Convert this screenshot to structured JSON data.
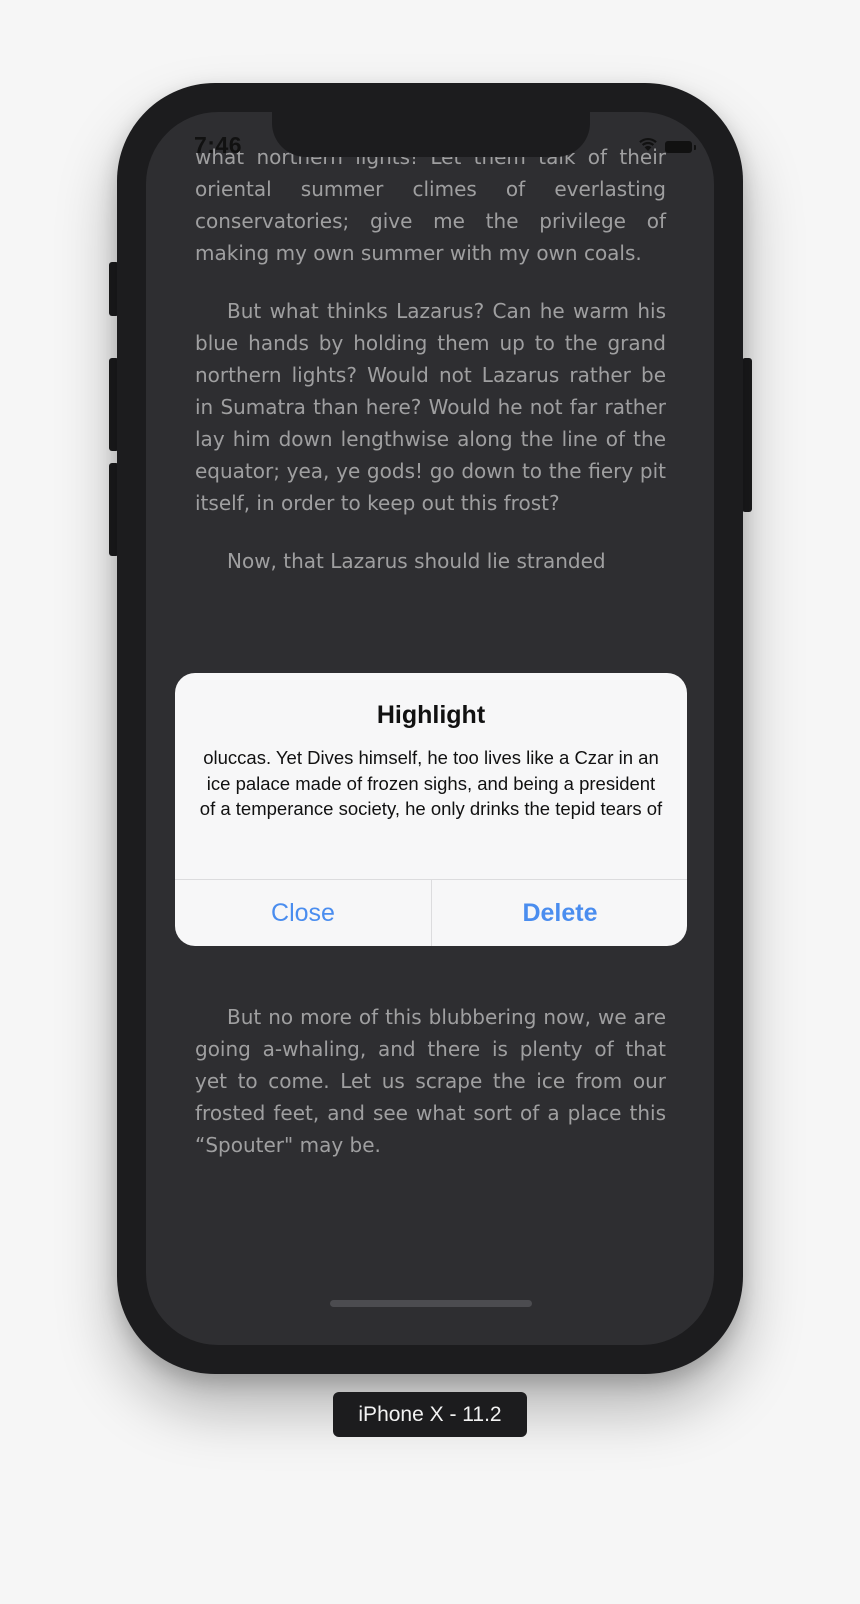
{
  "status_bar": {
    "time": "7:46",
    "icons": [
      "wifi-icon",
      "battery-icon"
    ]
  },
  "reader": {
    "paragraphs": [
      "what northern lights! Let them talk of their oriental summer climes of everlasting conservatories; give me the privilege of making my own summer with my own coals.",
      "But what thinks Lazarus? Can he warm his blue hands by holding them up to the grand northern lights? Would not Lazarus rather be in Sumatra than here? Would he not far rather lay him down lengthwise along the line of the equator; yea, ye gods! go down to the fiery pit itself, in order to keep out this frost?",
      "Now, that Lazarus should lie stranded",
      "But no more of this blubbering now, we are going a-whaling, and there is plenty of that yet to come. Let us scrape the ice from our frosted feet, and see what sort of a place this “Spouter\" may be."
    ]
  },
  "alert": {
    "title": "Highlight",
    "message": "oluccas. Yet Dives himself, he too lives like a Czar in an ice palace made of frozen sighs, and being a president of a temperance society, he only drinks the tepid tears of",
    "close_label": "Close",
    "delete_label": "Delete"
  },
  "device_label": "iPhone X - 11.2",
  "colors": {
    "background": "#f6f6f6",
    "phone_frame": "#1c1c1e",
    "screen": "#343438",
    "reader_text": "#bdbdbf",
    "alert_bg": "#f7f7f8",
    "accent": "#4a8def"
  }
}
